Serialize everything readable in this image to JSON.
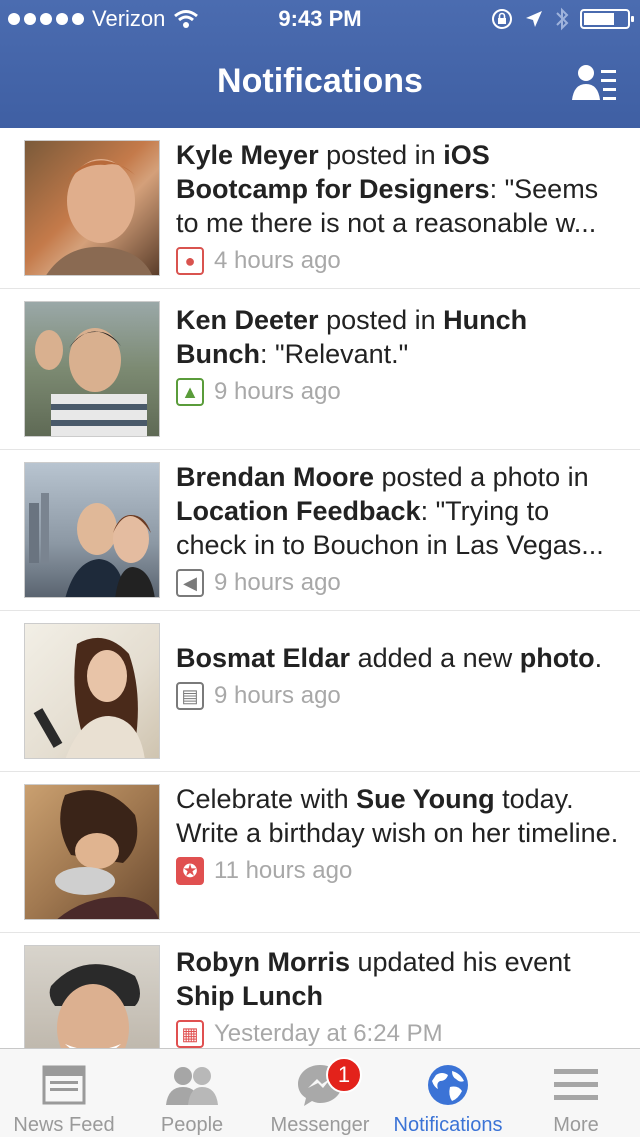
{
  "status": {
    "carrier": "Verizon",
    "time": "9:43 PM"
  },
  "header": {
    "title": "Notifications"
  },
  "notifications": [
    {
      "pre": "",
      "actor": "Kyle Meyer",
      "mid": " posted in ",
      "target": "iOS Bootcamp for Designers",
      "text": ": \"Seems to me there is not a reasonable w...",
      "time": "4 hours ago",
      "icon": "apple-icon",
      "icon_color": "#d9534f"
    },
    {
      "pre": "",
      "actor": "Ken Deeter",
      "mid": " posted in ",
      "target": "Hunch Bunch",
      "text": ": \"Relevant.\"",
      "time": "9 hours ago",
      "icon": "shoe-icon",
      "icon_color": "#5a9c3a"
    },
    {
      "pre": "",
      "actor": "Brendan Moore",
      "mid": " posted a photo in ",
      "target": "Location Feedback",
      "text": ": \"Trying to check in to Bouchon in Las Vegas...",
      "time": "9 hours ago",
      "icon": "megaphone-icon",
      "icon_color": "#7a7a7a"
    },
    {
      "pre": "",
      "actor": "Bosmat Eldar",
      "mid": " added a new ",
      "target": "photo",
      "text": ".",
      "time": "9 hours ago",
      "icon": "newsfeed-icon",
      "icon_color": "#7a7a7a"
    },
    {
      "pre": "Celebrate with ",
      "actor": "Sue Young",
      "mid": " today. Write a birthday wish on her timeline.",
      "target": "",
      "text": "",
      "time": "11 hours ago",
      "icon": "gift-icon",
      "icon_color": "#e05050"
    },
    {
      "pre": "",
      "actor": "Robyn Morris",
      "mid": " updated his event ",
      "target": "Ship Lunch",
      "text": "",
      "time": "Yesterday at 6:24 PM",
      "icon": "calendar-icon",
      "icon_color": "#e05050"
    }
  ],
  "tabs": [
    {
      "label": "News Feed",
      "icon": "newsfeed-icon"
    },
    {
      "label": "People",
      "icon": "people-icon"
    },
    {
      "label": "Messenger",
      "icon": "messenger-icon",
      "badge": "1"
    },
    {
      "label": "Notifications",
      "icon": "globe-icon"
    },
    {
      "label": "More",
      "icon": "menu-icon"
    }
  ]
}
